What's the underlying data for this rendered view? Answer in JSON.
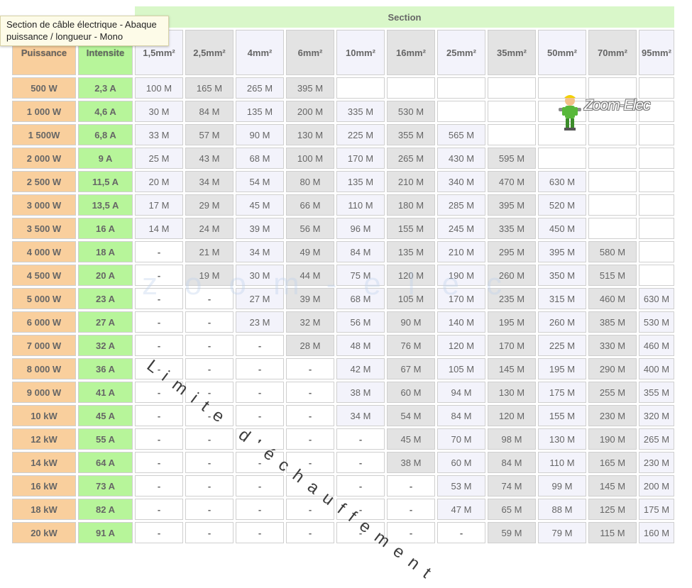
{
  "tooltip": "Section de câble électrique - Abaque puissance / longueur - Mono",
  "header": {
    "section_title": "Section",
    "power_label": "Puissance",
    "current_label": "Intensite",
    "sections": [
      "1,5mm²",
      "2,5mm²",
      "4mm²",
      "6mm²",
      "10mm²",
      "16mm²",
      "25mm²",
      "35mm²",
      "50mm²",
      "70mm²",
      "95mm²"
    ]
  },
  "logo_text": "Zoom-Elec",
  "watermark_text": "zoom-elec",
  "diagonal_label": "Limite d'échauffement",
  "colors": {
    "power_bg": "#f9cf9d",
    "current_bg": "#b7f59a",
    "section_title_bg": "#d9f7c9",
    "dash": "#e02020"
  },
  "rows": [
    {
      "power": "500 W",
      "current": "2,3 A",
      "values": [
        "100 M",
        "165 M",
        "265 M",
        "395 M",
        "",
        "",
        "",
        "",
        "",
        "",
        ""
      ]
    },
    {
      "power": "1 000 W",
      "current": "4,6 A",
      "values": [
        "30 M",
        "84 M",
        "135 M",
        "200 M",
        "335 M",
        "530 M",
        "",
        "",
        "",
        "",
        ""
      ]
    },
    {
      "power": "1 500W",
      "current": "6,8 A",
      "values": [
        "33 M",
        "57 M",
        "90 M",
        "130 M",
        "225 M",
        "355 M",
        "565 M",
        "",
        "",
        "",
        ""
      ]
    },
    {
      "power": "2 000 W",
      "current": "9 A",
      "values": [
        "25 M",
        "43 M",
        "68 M",
        "100 M",
        "170 M",
        "265 M",
        "430 M",
        "595 M",
        "",
        "",
        ""
      ]
    },
    {
      "power": "2 500 W",
      "current": "11,5 A",
      "values": [
        "20 M",
        "34 M",
        "54 M",
        "80 M",
        "135 M",
        "210 M",
        "340 M",
        "470 M",
        "630 M",
        "",
        ""
      ]
    },
    {
      "power": "3 000 W",
      "current": "13,5 A",
      "values": [
        "17 M",
        "29 M",
        "45 M",
        "66 M",
        "110 M",
        "180 M",
        "285 M",
        "395 M",
        "520 M",
        "",
        ""
      ]
    },
    {
      "power": "3 500 W",
      "current": "16 A",
      "values": [
        "14 M",
        "24 M",
        "39 M",
        "56 M",
        "96 M",
        "155 M",
        "245 M",
        "335 M",
        "450 M",
        "",
        ""
      ]
    },
    {
      "power": "4 000 W",
      "current": "18 A",
      "values": [
        "-",
        "21 M",
        "34 M",
        "49 M",
        "84 M",
        "135 M",
        "210 M",
        "295 M",
        "395 M",
        "580 M",
        ""
      ]
    },
    {
      "power": "4 500 W",
      "current": "20 A",
      "values": [
        "-",
        "19 M",
        "30 M",
        "44 M",
        "75 M",
        "120 M",
        "190 M",
        "260 M",
        "350 M",
        "515 M",
        ""
      ]
    },
    {
      "power": "5 000 W",
      "current": "23 A",
      "values": [
        "-",
        "-",
        "27 M",
        "39 M",
        "68 M",
        "105 M",
        "170 M",
        "235 M",
        "315 M",
        "460 M",
        "630 M"
      ]
    },
    {
      "power": "6 000 W",
      "current": "27 A",
      "values": [
        "-",
        "-",
        "23 M",
        "32 M",
        "56 M",
        "90 M",
        "140 M",
        "195 M",
        "260 M",
        "385 M",
        "530 M"
      ]
    },
    {
      "power": "7 000 W",
      "current": "32 A",
      "values": [
        "-",
        "-",
        "-",
        "28 M",
        "48 M",
        "76 M",
        "120 M",
        "170 M",
        "225 M",
        "330 M",
        "460 M"
      ]
    },
    {
      "power": "8 000 W",
      "current": "36 A",
      "values": [
        "-",
        "-",
        "-",
        "-",
        "42 M",
        "67 M",
        "105 M",
        "145 M",
        "195 M",
        "290 M",
        "400 M"
      ]
    },
    {
      "power": "9 000 W",
      "current": "41 A",
      "values": [
        "-",
        "-",
        "-",
        "-",
        "38 M",
        "60 M",
        "94 M",
        "130 M",
        "175 M",
        "255 M",
        "355 M"
      ]
    },
    {
      "power": "10 kW",
      "current": "45 A",
      "values": [
        "-",
        "-",
        "-",
        "-",
        "34 M",
        "54 M",
        "84 M",
        "120 M",
        "155 M",
        "230 M",
        "320 M"
      ]
    },
    {
      "power": "12 kW",
      "current": "55 A",
      "values": [
        "-",
        "-",
        "-",
        "-",
        "-",
        "45 M",
        "70 M",
        "98 M",
        "130 M",
        "190 M",
        "265 M"
      ]
    },
    {
      "power": "14 kW",
      "current": "64 A",
      "values": [
        "-",
        "-",
        "-",
        "-",
        "-",
        "38 M",
        "60 M",
        "84 M",
        "110 M",
        "165 M",
        "230 M"
      ]
    },
    {
      "power": "16 kW",
      "current": "73 A",
      "values": [
        "-",
        "-",
        "-",
        "-",
        "-",
        "-",
        "53 M",
        "74 M",
        "99 M",
        "145 M",
        "200 M"
      ]
    },
    {
      "power": "18 kW",
      "current": "82 A",
      "values": [
        "-",
        "-",
        "-",
        "-",
        "-",
        "-",
        "47 M",
        "65 M",
        "88 M",
        "125 M",
        "175 M"
      ]
    },
    {
      "power": "20 kW",
      "current": "91 A",
      "values": [
        "-",
        "-",
        "-",
        "-",
        "-",
        "-",
        "-",
        "59 M",
        "79 M",
        "115 M",
        "160 M"
      ]
    }
  ]
}
